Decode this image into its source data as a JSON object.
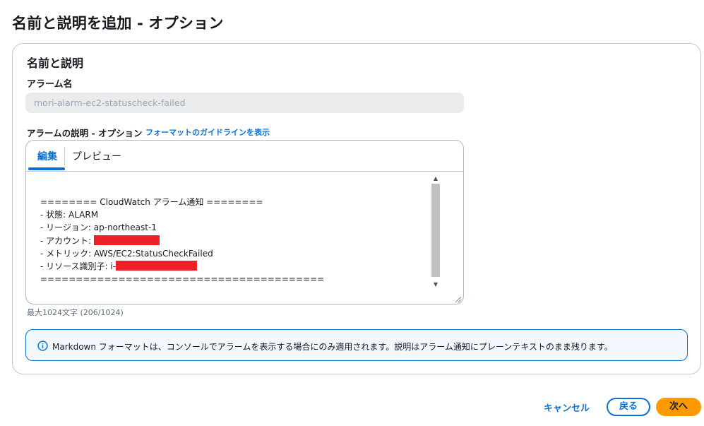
{
  "page": {
    "title": "名前と説明を追加 - オプション"
  },
  "section": {
    "title": "名前と説明"
  },
  "alarm_name": {
    "label": "アラーム名",
    "value": "mori-alarm-ec2-statuscheck-failed"
  },
  "description": {
    "label": "アラームの説明 - オプション",
    "guide_link": "フォーマットのガイドラインを表示",
    "tabs": [
      "編集",
      "プレビュー"
    ],
    "active_tab": "編集",
    "lines": [
      "======== CloudWatch アラーム通知 ========",
      "- 状態: ALARM",
      "- リージョン: ap-northeast-1",
      "- アカウント: ",
      "- メトリック: AWS/EC2:StatusCheckFailed",
      "- リソース識別子: i-",
      "========================================"
    ],
    "char_count": "最大1024文字 (206/1024)"
  },
  "info": {
    "text": "Markdown フォーマットは、コンソールでアラームを表示する場合にのみ適用されます。説明はアラーム通知にプレーンテキストのまま残ります。"
  },
  "footer": {
    "cancel": "キャンセル",
    "back": "戻る",
    "next": "次へ"
  },
  "colors": {
    "accent": "#0972d3",
    "primary_button": "#ff9900",
    "redaction": "#ee2128"
  }
}
